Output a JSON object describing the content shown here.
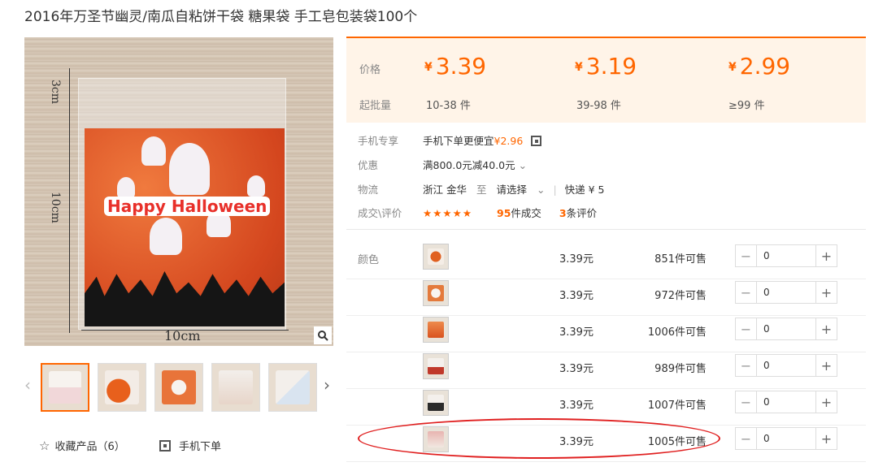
{
  "product": {
    "title": "2016年万圣节幽灵/南瓜自粘饼干袋 糖果袋 手工皂包装袋100个"
  },
  "image": {
    "print_text": "Happy Halloween",
    "dim_top": "3cm",
    "dim_side": "10cm",
    "dim_bottom": "10cm",
    "zoom_icon": "magnifier-icon"
  },
  "gallery": {
    "prev": "‹",
    "next": "›",
    "thumb_count": 5
  },
  "actions": {
    "favorite_label": "收藏产品（6）",
    "mobile_order_label": "手机下单"
  },
  "price_panel": {
    "price_label": "价格",
    "moq_label": "起批量",
    "tiers": [
      {
        "currency": "¥",
        "price": "3.39",
        "qty": "10-38 件"
      },
      {
        "currency": "¥",
        "price": "3.19",
        "qty": "39-98 件"
      },
      {
        "currency": "¥",
        "price": "2.99",
        "qty": "≥99 件"
      }
    ]
  },
  "info": {
    "mobile": {
      "label": "手机专享",
      "text": "手机下单更便宜",
      "price": "¥2.96"
    },
    "promo": {
      "label": "优惠",
      "text": "满800.0元减40.0元"
    },
    "shipping": {
      "label": "物流",
      "origin": "浙江 金华",
      "to": "至",
      "dest": "请选择",
      "method": "快递 ¥ 5"
    },
    "deals": {
      "label": "成交\\评价",
      "stars": "★★★★★",
      "sold_num": "95",
      "sold_text": "件成交",
      "review_num": "3",
      "review_text": "条评价"
    }
  },
  "sku": {
    "label": "颜色",
    "rows": [
      {
        "price": "3.39元",
        "stock": "851件可售",
        "qty": "0"
      },
      {
        "price": "3.39元",
        "stock": "972件可售",
        "qty": "0"
      },
      {
        "price": "3.39元",
        "stock": "1006件可售",
        "qty": "0"
      },
      {
        "price": "3.39元",
        "stock": "989件可售",
        "qty": "0"
      },
      {
        "price": "3.39元",
        "stock": "1007件可售",
        "qty": "0"
      },
      {
        "price": "3.39元",
        "stock": "1005件可售",
        "qty": "0"
      }
    ],
    "minus": "−",
    "plus": "+"
  },
  "colors": {
    "accent": "#ff6600",
    "price_bg": "#fff4e8",
    "annotation": "#e02020"
  }
}
